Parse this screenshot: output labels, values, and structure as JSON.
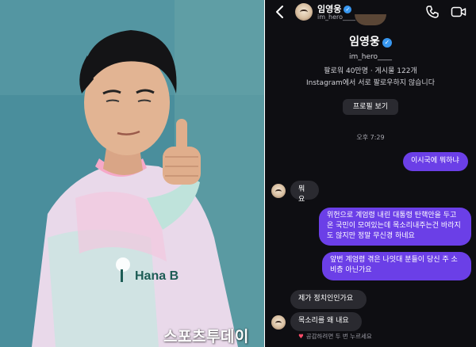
{
  "watermark": "스포츠투데이",
  "photo": {
    "jersey_logo_text": "Hana B"
  },
  "header": {
    "name": "임영웅",
    "handle": "im_hero____"
  },
  "profile": {
    "name": "임영웅",
    "handle": "im_hero____",
    "stats": "팔로워 40만명 · 게시물 122개",
    "follow_status": "Instagram에서 서로 팔로우하지 않습니다",
    "view_profile_label": "프로필 보기"
  },
  "timestamp": "오후 7:29",
  "messages": {
    "m1": "이시국에 뭐하냐",
    "m2": "뭐요",
    "m3": "위헌으로 계엄령 내린 대통령 탄핵안을 두고 온 국민이 모여있는데 목소리내주는건 바라지도 않지만 정말 무신경 하네요",
    "m4": "앞번 계엄령 겪은 나잇대 분들이 당신 주 소비층 아닌가요",
    "m5": "제가 정치인인가요",
    "m6": "목소리를 왜 내요"
  },
  "reaction_note": "공감하려면 두 번 누르세요",
  "icons": {
    "back": "chevron-left-icon",
    "call": "phone-icon",
    "video": "video-camera-icon",
    "verified": "verified-badge-icon",
    "heart": "heart-icon"
  },
  "colors": {
    "chat_background": "#0e0e12",
    "outgoing_bubble": "#6b3fe7",
    "incoming_bubble": "#2a2a30",
    "verified_blue": "#3897f0"
  }
}
